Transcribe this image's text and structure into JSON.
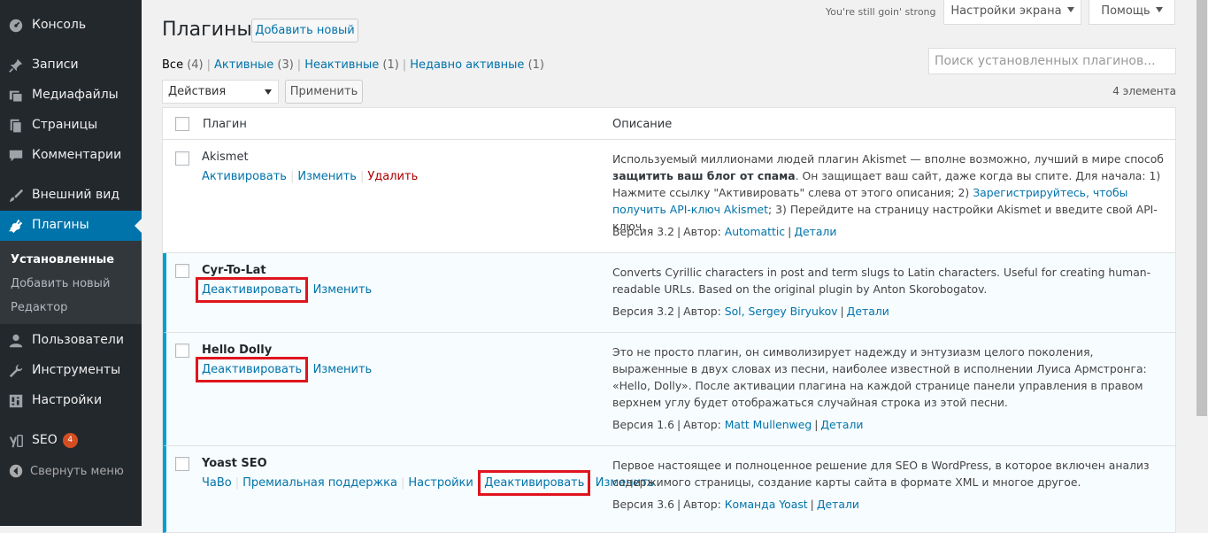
{
  "sidebar": {
    "items": [
      {
        "label": "Консоль",
        "icon": "dashboard-icon"
      },
      {
        "label": "Записи",
        "icon": "pin-icon"
      },
      {
        "label": "Медиафайлы",
        "icon": "media-icon"
      },
      {
        "label": "Страницы",
        "icon": "pages-icon"
      },
      {
        "label": "Комментарии",
        "icon": "comment-icon"
      },
      {
        "label": "Внешний вид",
        "icon": "brush-icon"
      },
      {
        "label": "Плагины",
        "icon": "plugin-icon"
      },
      {
        "label": "Пользователи",
        "icon": "users-icon"
      },
      {
        "label": "Инструменты",
        "icon": "wrench-icon"
      },
      {
        "label": "Настройки",
        "icon": "settings-icon"
      },
      {
        "label": "SEO",
        "icon": "yoast-icon",
        "badge": "4"
      }
    ],
    "submenu": [
      "Установленные",
      "Добавить новый",
      "Редактор"
    ],
    "collapse_label": "Свернуть меню"
  },
  "header": {
    "title": "Плагины",
    "add_new": "Добавить новый",
    "tagline": "You're still goin' strong",
    "screen_options": "Настройки экрана",
    "help": "Помощь"
  },
  "filters": {
    "all": "Все",
    "all_count": "(4)",
    "active": "Активные",
    "active_count": "(3)",
    "inactive": "Неактивные",
    "inactive_count": "(1)",
    "recent": "Недавно активные",
    "recent_count": "(1)"
  },
  "search": {
    "placeholder": "Поиск установленных плагинов..."
  },
  "bulk": {
    "selected": "Действия",
    "apply": "Применить",
    "count": "4 элемента"
  },
  "table": {
    "col_plugin": "Плагин",
    "col_description": "Описание",
    "rows": [
      {
        "name": "Akismet",
        "actions": [
          "Активировать",
          "Изменить",
          "Удалить"
        ],
        "desc_1": "Используемый миллионами людей плагин Akismet — вполне возможно, лучший в мире способ ",
        "desc_bold": "защитить ваш блог от спама",
        "desc_2": ". Он защищает ваш сайт, даже когда вы спите. Для начала: 1) Нажмите ссылку \"Активировать\" слева от этого описания; 2) ",
        "desc_link": "Зарегистрируйтесь, чтобы получить API-ключ Akismet",
        "desc_3": "; 3) Перейдите на страницу настройки Akismet и введите свой API-ключ.",
        "version": "Версия 3.2",
        "author_label": "Автор:",
        "author": "Automattic",
        "details": "Детали"
      },
      {
        "name": "Cyr-To-Lat",
        "actions": [
          "Деактивировать",
          "Изменить"
        ],
        "desc": "Converts Cyrillic characters in post and term slugs to Latin characters. Useful for creating human-readable URLs. Based on the original plugin by Anton Skorobogatov.",
        "version": "Версия 3.2",
        "author_label": "Автор:",
        "author": "Sol, Sergey Biryukov",
        "details": "Детали"
      },
      {
        "name": "Hello Dolly",
        "actions": [
          "Деактивировать",
          "Изменить"
        ],
        "desc": "Это не просто плагин, он символизирует надежду и энтузиазм целого поколения, выраженные в двух словах из песни, наиболее известной в исполнении Луиса Армстронга: «Hello, Dolly». После активации плагина на каждой странице панели управления в правом верхнем углу будет отображаться случайная строка из этой песни.",
        "version": "Версия 1.6",
        "author_label": "Автор:",
        "author": "Matt Mullenweg",
        "details": "Детали"
      },
      {
        "name": "Yoast SEO",
        "actions": [
          "ЧаВо",
          "Премиальная поддержка",
          "Настройки",
          "Деактивировать",
          "Изменить"
        ],
        "desc": "Первое настоящее и полноценное решение для SEO в WordPress, в которое включен анализ содержимого страницы, создание карты сайта в формате XML и многое другое.",
        "version": "Версия 3.6",
        "author_label": "Автор:",
        "author": "Команда Yoast",
        "details": "Детали"
      }
    ]
  },
  "colors": {
    "sidebar_bg": "#23282d",
    "accent": "#0073aa",
    "active_border": "#00a0d2",
    "highlight": "#e0141e"
  }
}
